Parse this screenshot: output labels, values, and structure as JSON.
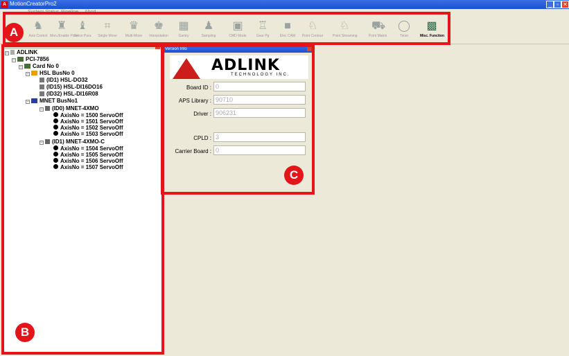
{
  "window": {
    "title": "MotionCreatorPro2",
    "app_icon": "A",
    "btn_minimize": "_",
    "btn_restore": "▫",
    "btn_close": "✕"
  },
  "menu": [
    "System Status",
    "Pipeline",
    "Abort"
  ],
  "toolbar": [
    {
      "label": "Axis Control",
      "icon": "axis-icon"
    },
    {
      "label": "Mon./Enable Point",
      "icon": "monitor-icon"
    },
    {
      "label": "Servo Para",
      "icon": "servo-icon"
    },
    {
      "label": "Single Move",
      "icon": "single-move-icon"
    },
    {
      "label": "Multi-Move",
      "icon": "multi-move-icon"
    },
    {
      "label": "Interpolation",
      "icon": "interpolation-icon"
    },
    {
      "label": "Gantry",
      "icon": "gantry-icon"
    },
    {
      "label": "Sampling",
      "icon": "sampling-icon"
    },
    {
      "label": "CMD Mode",
      "icon": "cmd-icon"
    },
    {
      "label": "Gear Pg",
      "icon": "gear-icon"
    },
    {
      "label": "Elec CAM",
      "icon": "cam-icon"
    },
    {
      "label": "Point Contour",
      "icon": "point-icon"
    },
    {
      "label": "Point Streaming",
      "icon": "streaming-icon"
    },
    {
      "label": "Point Matrix",
      "icon": "matrix-icon"
    },
    {
      "label": "Timer",
      "icon": "timer-icon"
    },
    {
      "label": "Misc. Function",
      "icon": "misc-icon"
    }
  ],
  "tree": {
    "root": "ADLINK",
    "card_model": "PCI-7856",
    "card": "Card No 0",
    "hsl_bus": "HSL BusNo 0",
    "hsl_modules": [
      "(ID1) HSL-DO32",
      "(ID15) HSL-DI16DO16",
      "(ID32) HSL-DI16R08"
    ],
    "mnet_bus": "MNET BusNo1",
    "mnet_modules": [
      {
        "name": "(ID0) MNET-4XMO",
        "axes": [
          "AxisNo = 1500 ServoOff",
          "AxisNo = 1501 ServoOff",
          "AxisNo = 1502 ServoOff",
          "AxisNo = 1503 ServoOff"
        ]
      },
      {
        "name": "(ID1) MNET-4XMO-C",
        "axes": [
          "AxisNo = 1504 ServoOff",
          "AxisNo = 1505 ServoOff",
          "AxisNo = 1506 ServoOff",
          "AxisNo = 1507 ServoOff"
        ]
      }
    ]
  },
  "info": {
    "title": "Version Info",
    "logo_text": "ADLINK",
    "logo_sub": "TECHNOLOGY INC.",
    "fields": [
      {
        "label": "Board ID :",
        "value": "0"
      },
      {
        "label": "APS Library :",
        "value": "90710"
      },
      {
        "label": "Driver :",
        "value": "906231"
      },
      {
        "label": "CPLD :",
        "value": "3"
      },
      {
        "label": "Carrier Board :",
        "value": "0"
      }
    ]
  },
  "callouts": {
    "a": "A",
    "b": "B",
    "c": "C"
  },
  "colors": {
    "callout": "#e3151b",
    "titlebar": "#1e4fd0",
    "background": "#ece9d8"
  }
}
